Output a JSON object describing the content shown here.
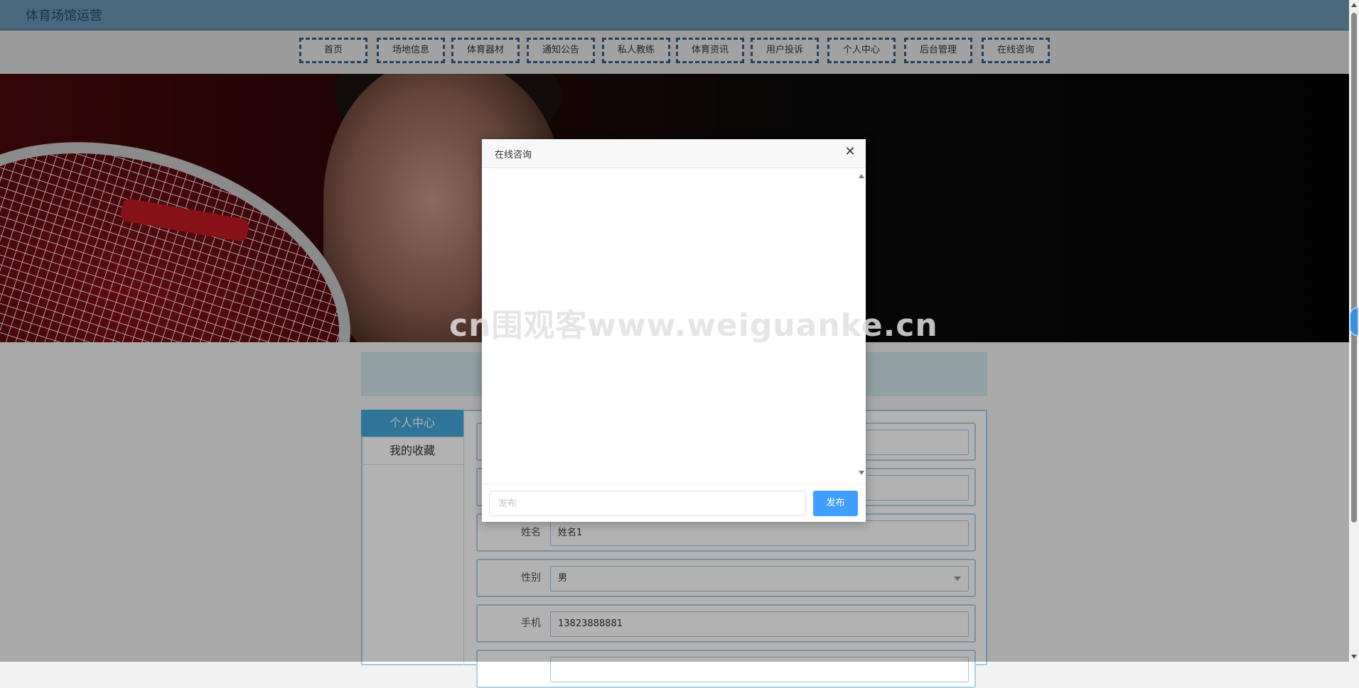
{
  "site": {
    "title": "体育场馆运营"
  },
  "nav": {
    "items": [
      {
        "label": "首页"
      },
      {
        "label": "场地信息"
      },
      {
        "label": "体育器材"
      },
      {
        "label": "通知公告"
      },
      {
        "label": "私人教练"
      },
      {
        "label": "体育资讯"
      },
      {
        "label": "用户投诉"
      },
      {
        "label": "个人中心"
      },
      {
        "label": "后台管理"
      },
      {
        "label": "在线咨询"
      }
    ]
  },
  "banner": {
    "watermark": "cn围观客www.weiguanke.cn"
  },
  "sidebar": {
    "items": [
      {
        "label": "个人中心",
        "active": true
      },
      {
        "label": "我的收藏",
        "active": false
      }
    ]
  },
  "form": {
    "name": {
      "label": "姓名",
      "value": "姓名1"
    },
    "gender": {
      "label": "性别",
      "value": "男"
    },
    "phone": {
      "label": "手机",
      "value": "13823888881"
    }
  },
  "modal": {
    "title": "在线咨询",
    "input_placeholder": "发布",
    "send_label": "发布"
  },
  "colors": {
    "header_bg": "#6a97b4",
    "nav_border": "#315f88",
    "sidebar_active": "#43a8db",
    "send_button": "#409eff"
  }
}
